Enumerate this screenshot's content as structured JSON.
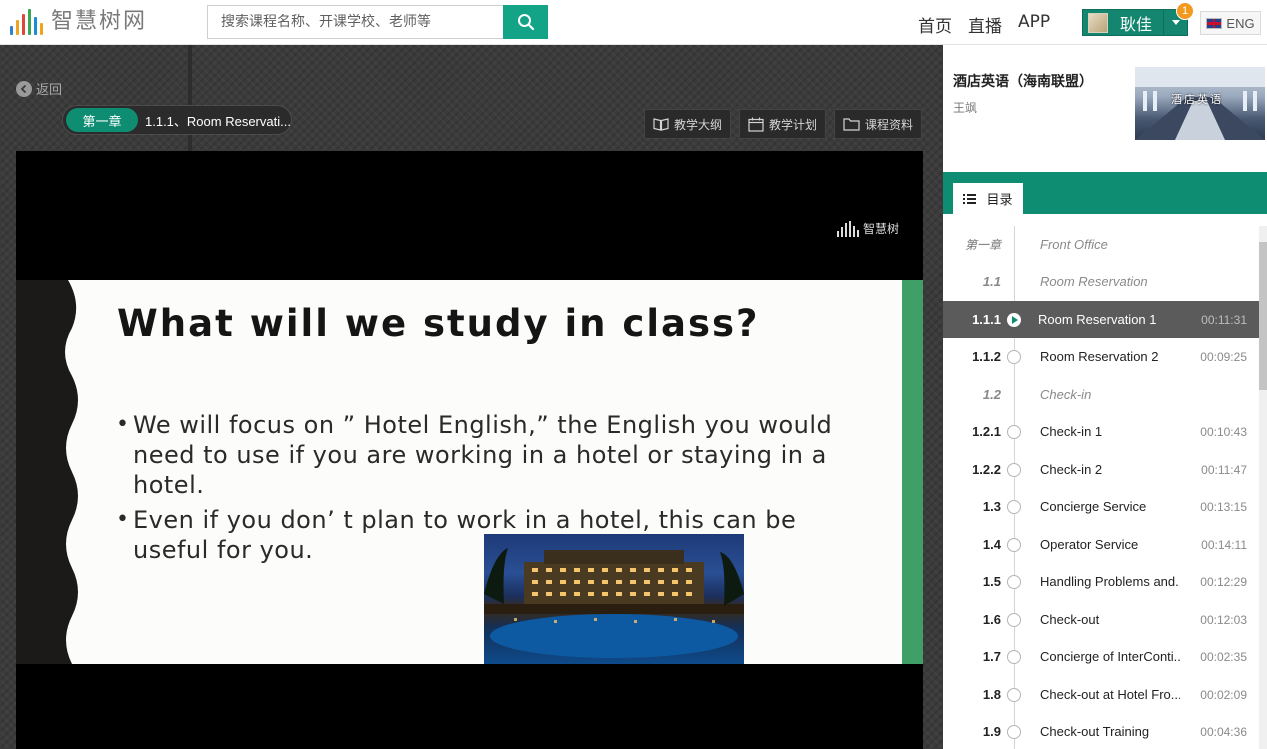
{
  "header": {
    "logo_text": "智慧树网",
    "search_placeholder": "搜索课程名称、开课学校、老师等",
    "nav": [
      "首页",
      "直播",
      "APP"
    ],
    "user_name": "耿佳",
    "notification_count": "1",
    "lang_label": "ENG"
  },
  "toolbar": {
    "back_label": "返回",
    "chapter_tag": "第一章",
    "chapter_title": "1.1.1、Room Reservati...",
    "buttons": [
      "教学大纲",
      "教学计划",
      "课程资料"
    ]
  },
  "video": {
    "watermark": "智慧树",
    "slide_title": "What will we study in class?",
    "bullets": [
      "We will focus on ” Hotel English,”  the English you would need to use if you are working in a hotel or staying in a hotel.",
      "Even if you don’ t plan to work in a hotel, this can be useful for you."
    ]
  },
  "course": {
    "title": "酒店英语（海南联盟）",
    "teacher": "王飒",
    "thumb_text": "酒店英语"
  },
  "tab_label": "目录",
  "toc": [
    {
      "num": "第一章",
      "label": "Front Office",
      "time": "",
      "kind": "chapter"
    },
    {
      "num": "1.1",
      "label": "Room Reservation",
      "time": "",
      "kind": "section"
    },
    {
      "num": "1.1.1",
      "label": "Room Reservation 1",
      "time": "00:11:31",
      "kind": "active"
    },
    {
      "num": "1.1.2",
      "label": "Room Reservation 2",
      "time": "00:09:25",
      "kind": "lesson"
    },
    {
      "num": "1.2",
      "label": "Check-in",
      "time": "",
      "kind": "section"
    },
    {
      "num": "1.2.1",
      "label": "Check-in 1",
      "time": "00:10:43",
      "kind": "lesson"
    },
    {
      "num": "1.2.2",
      "label": "Check-in 2",
      "time": "00:11:47",
      "kind": "lesson"
    },
    {
      "num": "1.3",
      "label": "Concierge Service",
      "time": "00:13:15",
      "kind": "lesson"
    },
    {
      "num": "1.4",
      "label": "Operator Service",
      "time": "00:14:11",
      "kind": "lesson"
    },
    {
      "num": "1.5",
      "label": "Handling Problems and...",
      "time": "00:12:29",
      "kind": "lesson"
    },
    {
      "num": "1.6",
      "label": "Check-out",
      "time": "00:12:03",
      "kind": "lesson"
    },
    {
      "num": "1.7",
      "label": "Concierge of InterConti...",
      "time": "00:02:35",
      "kind": "lesson"
    },
    {
      "num": "1.8",
      "label": "Check-out at Hotel Fro...",
      "time": "00:02:09",
      "kind": "lesson"
    },
    {
      "num": "1.9",
      "label": "Check-out Training",
      "time": "00:04:36",
      "kind": "lesson"
    }
  ],
  "colors": {
    "brand": "#0f8d73",
    "search_btn": "#13a387",
    "badge": "#f39a1e"
  }
}
